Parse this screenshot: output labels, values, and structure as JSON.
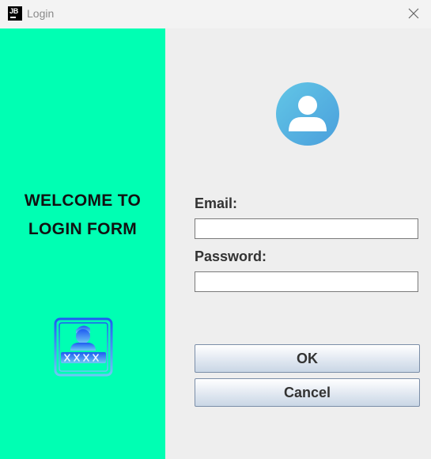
{
  "window": {
    "title": "Login",
    "app_icon_text": "JB",
    "close_icon": "close-icon"
  },
  "left_panel": {
    "background": "#00ffb3",
    "welcome_line1": "WELCOME TO",
    "welcome_line2": "LOGIN FORM",
    "icon": "user-password-icon"
  },
  "form": {
    "avatar_icon": "user-avatar-icon",
    "email_label": "Email:",
    "email_value": "",
    "password_label": "Password:",
    "password_value": "",
    "ok_label": "OK",
    "cancel_label": "Cancel"
  },
  "colors": {
    "accent_green": "#00ffb3",
    "avatar_blue": "#4fb3e0",
    "icon_blue": "#2f6bf0"
  }
}
